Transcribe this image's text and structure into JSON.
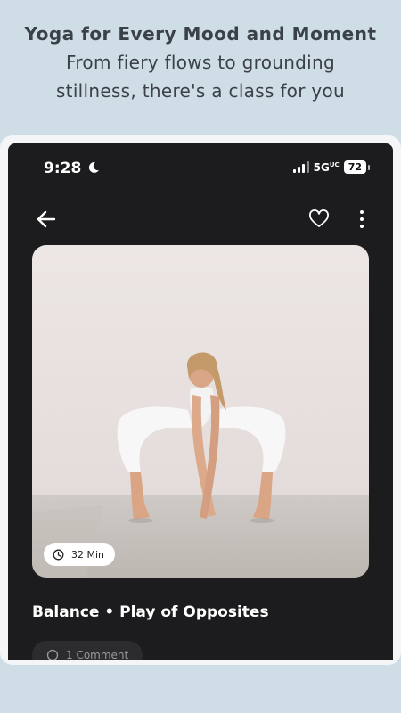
{
  "promo": {
    "title": "Yoga for Every Mood and Moment",
    "subtitle": "From fiery flows to grounding stillness, there's a class for you"
  },
  "status_bar": {
    "time": "9:28",
    "network": "5G",
    "network_suffix": "UC",
    "battery": "72"
  },
  "class": {
    "duration": "32 Min",
    "title": "Balance • Play of Opposites",
    "comments": "1 Comment"
  },
  "icons": [
    "back-arrow-icon",
    "heart-icon",
    "more-vertical-icon",
    "clock-icon",
    "comment-icon",
    "moon-icon"
  ],
  "colors": {
    "background": "#cfdde6",
    "screen": "#1c1c1e",
    "text_promo": "#3a4148"
  }
}
